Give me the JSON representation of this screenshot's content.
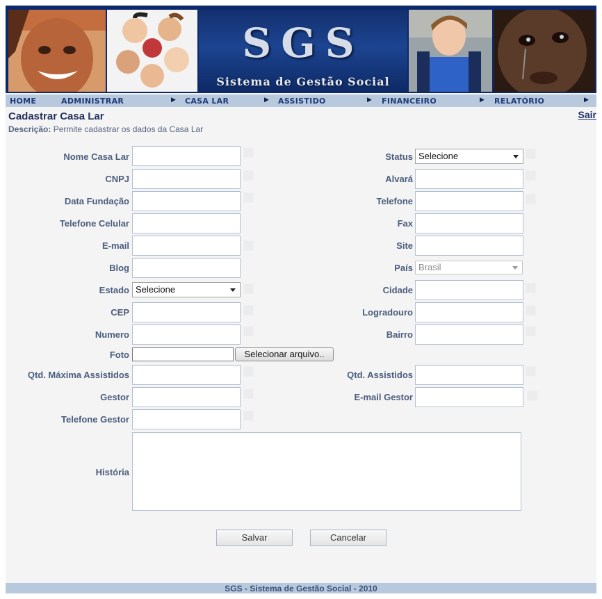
{
  "banner": {
    "logo_text": "SGS",
    "subtitle": "Sistema de Gestão Social"
  },
  "menu": {
    "items": [
      "HOME",
      "ADMINISTRAR",
      "CASA LAR",
      "ASSISTIDO",
      "FINANCEIRO",
      "RELATÓRIO"
    ],
    "arrow_glyph": "▶"
  },
  "header": {
    "title": "Cadastrar Casa Lar",
    "logout_label": "Sair",
    "description_label": "Descrição:",
    "description_text": "Permite cadastrar os dados da Casa Lar"
  },
  "form": {
    "left": {
      "nome_casa_lar": "Nome Casa Lar",
      "cnpj": "CNPJ",
      "data_fundacao": "Data Fundação",
      "telefone_celular": "Telefone Celular",
      "email": "E-mail",
      "blog": "Blog",
      "estado": "Estado",
      "cep": "CEP",
      "numero": "Numero",
      "foto": "Foto",
      "qtd_maxima": "Qtd. Máxima Assistidos",
      "gestor": "Gestor",
      "telefone_gestor": "Telefone Gestor"
    },
    "right": {
      "status": "Status",
      "alvara": "Alvará",
      "telefone": "Telefone",
      "fax": "Fax",
      "site": "Site",
      "pais": "País",
      "cidade": "Cidade",
      "logradouro": "Logradouro",
      "bairro": "Bairro",
      "qtd_assistidos": "Qtd. Assistidos",
      "email_gestor": "E-mail Gestor"
    },
    "historia": "História",
    "status_value": "Selecione",
    "estado_value": "Selecione",
    "pais_value": "Brasil",
    "file_button_label": "Selecionar arquivo..",
    "save_label": "Salvar",
    "cancel_label": "Cancelar"
  },
  "footer": {
    "text": "SGS - Sistema de Gestão Social - 2010"
  }
}
